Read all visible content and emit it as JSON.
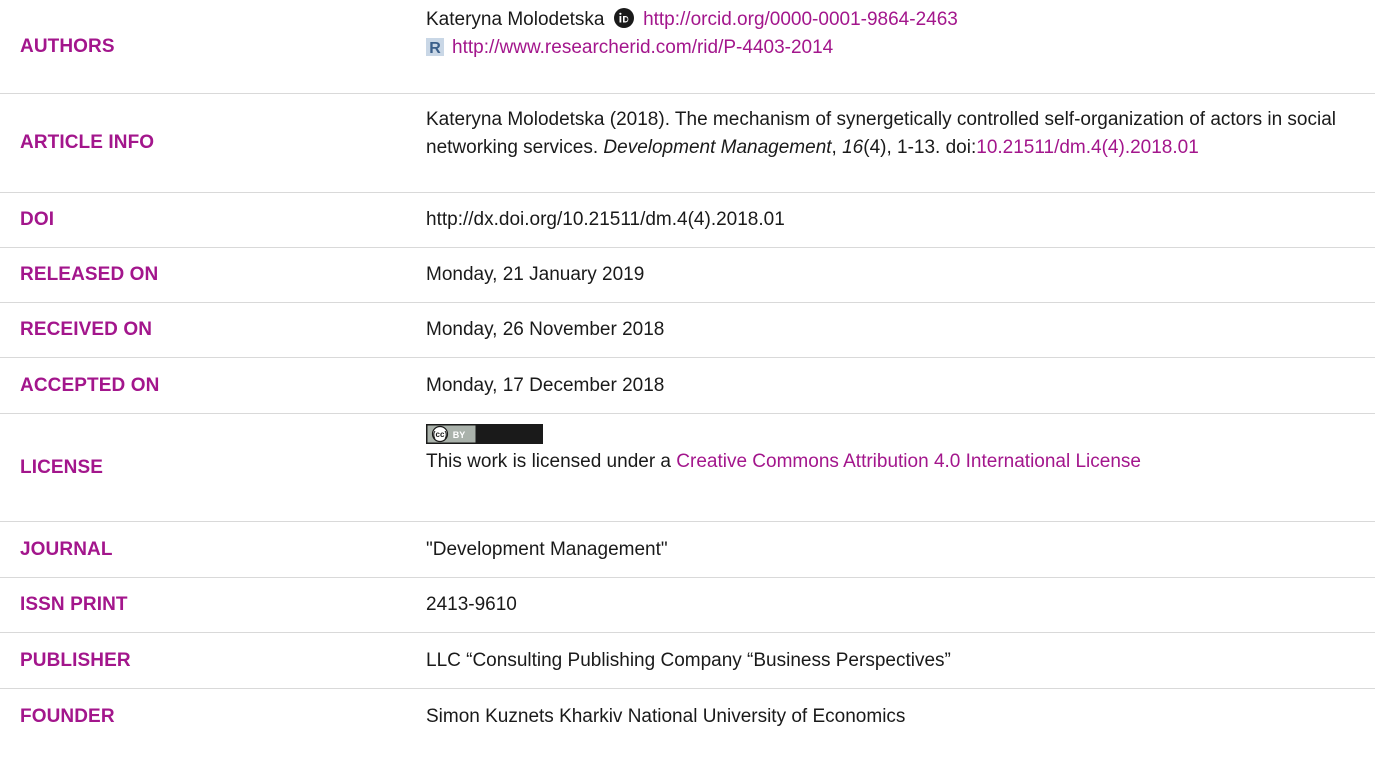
{
  "authors": {
    "label": "AUTHORS",
    "name": "Kateryna Molodetska",
    "orcid_icon": "orcid-icon",
    "orcid_url": "http://orcid.org/0000-0001-9864-2463",
    "rid_icon": "researcherid-icon",
    "rid_url": "http://www.researcherid.com/rid/P-4403-2014"
  },
  "article_info": {
    "label": "ARTICLE INFO",
    "citation_pre": "Kateryna Molodetska (2018). The mechanism of synergetically controlled self-organization of actors in social networking services. ",
    "journal": "Development Management",
    "sep1": ", ",
    "volume": "16",
    "issue_pages": "(4), 1-13. doi:",
    "doi_link": "10.21511/dm.4(4).2018.01"
  },
  "doi": {
    "label": "DOI",
    "value": "http://dx.doi.org/10.21511/dm.4(4).2018.01"
  },
  "released": {
    "label": "RELEASED ON",
    "value": "Monday, 21 January 2019"
  },
  "received": {
    "label": "RECEIVED ON",
    "value": "Monday, 26 November 2018"
  },
  "accepted": {
    "label": "ACCEPTED ON",
    "value": "Monday, 17 December 2018"
  },
  "license": {
    "label": "LICENSE",
    "badge_icon": "cc-by-badge-icon",
    "badge_text_cc": "(cc)",
    "badge_text_by": "BY",
    "text_pre": "This work is licensed under a ",
    "link": "Creative Commons Attribution 4.0 International License"
  },
  "journal": {
    "label": "JOURNAL",
    "value": "\"Development Management\""
  },
  "issn": {
    "label": "ISSN PRINT",
    "value": "2413-9610"
  },
  "publisher": {
    "label": "PUBLISHER",
    "value": "LLC “Consulting Publishing Company “Business Perspectives”"
  },
  "founder": {
    "label": "FOUNDER",
    "value": "Simon Kuznets Kharkiv National University of Economics"
  },
  "colors": {
    "label": "#a3168c",
    "link": "#a3168c",
    "text": "#1a1a1a",
    "rule": "#d9d9d9"
  }
}
